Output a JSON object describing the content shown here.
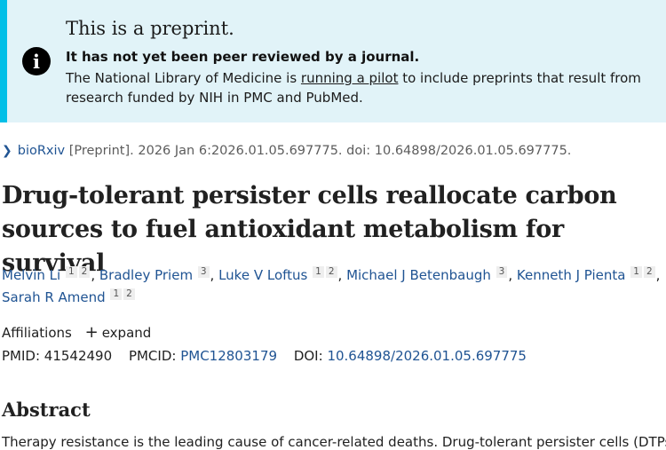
{
  "notice": {
    "icon": "info-icon",
    "title": "This is a preprint.",
    "subtitle": "It has not yet been peer reviewed by a journal.",
    "body_before": "The National Library of Medicine is ",
    "body_link": "running a pilot",
    "body_after": " to include preprints that result from research funded by NIH in PMC and PubMed.",
    "bg_color": "#e1f3f8",
    "accent_color": "#02bfe7"
  },
  "citation": {
    "journal": "bioRxiv",
    "rest": " [Preprint]. 2026 Jan 6:2026.01.05.697775. doi: 10.64898/2026.01.05.697775."
  },
  "article": {
    "title": "Drug-tolerant persister cells reallocate carbon sources to fuel antioxidant metabolism for survival"
  },
  "authors": [
    {
      "name": "Melvin Li",
      "affs": [
        "1",
        "2"
      ]
    },
    {
      "name": "Bradley Priem",
      "affs": [
        "3"
      ]
    },
    {
      "name": "Luke V Loftus",
      "affs": [
        "1",
        "2"
      ]
    },
    {
      "name": "Michael J Betenbaugh",
      "affs": [
        "3"
      ]
    },
    {
      "name": "Kenneth J Pienta",
      "affs": [
        "1",
        "2"
      ]
    },
    {
      "name": "Sarah R Amend",
      "affs": [
        "1",
        "2"
      ]
    }
  ],
  "affiliations": {
    "label": "Affiliations",
    "expand_label": "expand"
  },
  "ids": {
    "pmid_label": "PMID:",
    "pmid": "41542490",
    "pmcid_label": "PMCID:",
    "pmcid": "PMC12803179",
    "doi_label": "DOI:",
    "doi": "10.64898/2026.01.05.697775"
  },
  "abstract": {
    "heading": "Abstract",
    "text_partial": "Therapy resistance is the leading cause of cancer-related deaths. Drug-tolerant persister cells (DTPs)"
  },
  "colors": {
    "link": "#205493",
    "text": "#212121"
  }
}
